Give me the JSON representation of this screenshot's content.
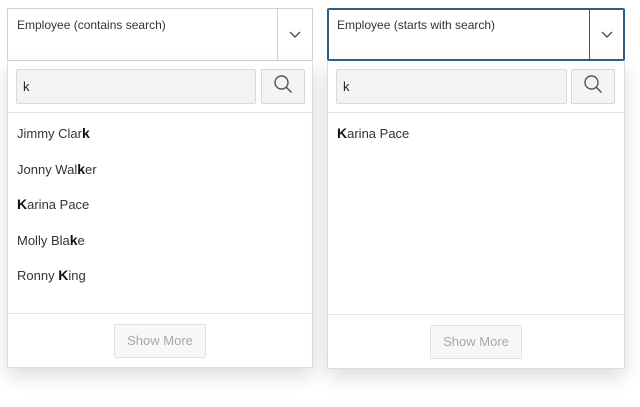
{
  "combos": [
    {
      "id": "contains",
      "label": "Employee (contains search)",
      "focused": false,
      "search_value": "k",
      "items": [
        {
          "pre": "Jimmy Clar",
          "match": "k",
          "post": ""
        },
        {
          "pre": "Jonny Wal",
          "match": "k",
          "post": "er"
        },
        {
          "pre": "",
          "match": "K",
          "post": "arina Pace"
        },
        {
          "pre": "Molly Bla",
          "match": "k",
          "post": "e"
        },
        {
          "pre": "Ronny ",
          "match": "K",
          "post": "ing"
        }
      ],
      "show_more_label": "Show More"
    },
    {
      "id": "starts",
      "label": "Employee (starts with search)",
      "focused": true,
      "search_value": "k",
      "items": [
        {
          "pre": "",
          "match": "K",
          "post": "arina Pace"
        }
      ],
      "show_more_label": "Show More"
    }
  ],
  "icons": {
    "dropdown": "chevron-down-icon",
    "search": "search-icon"
  },
  "colors": {
    "focus_border": "#2b5f8a",
    "disabled_text": "#a8a8a8"
  }
}
